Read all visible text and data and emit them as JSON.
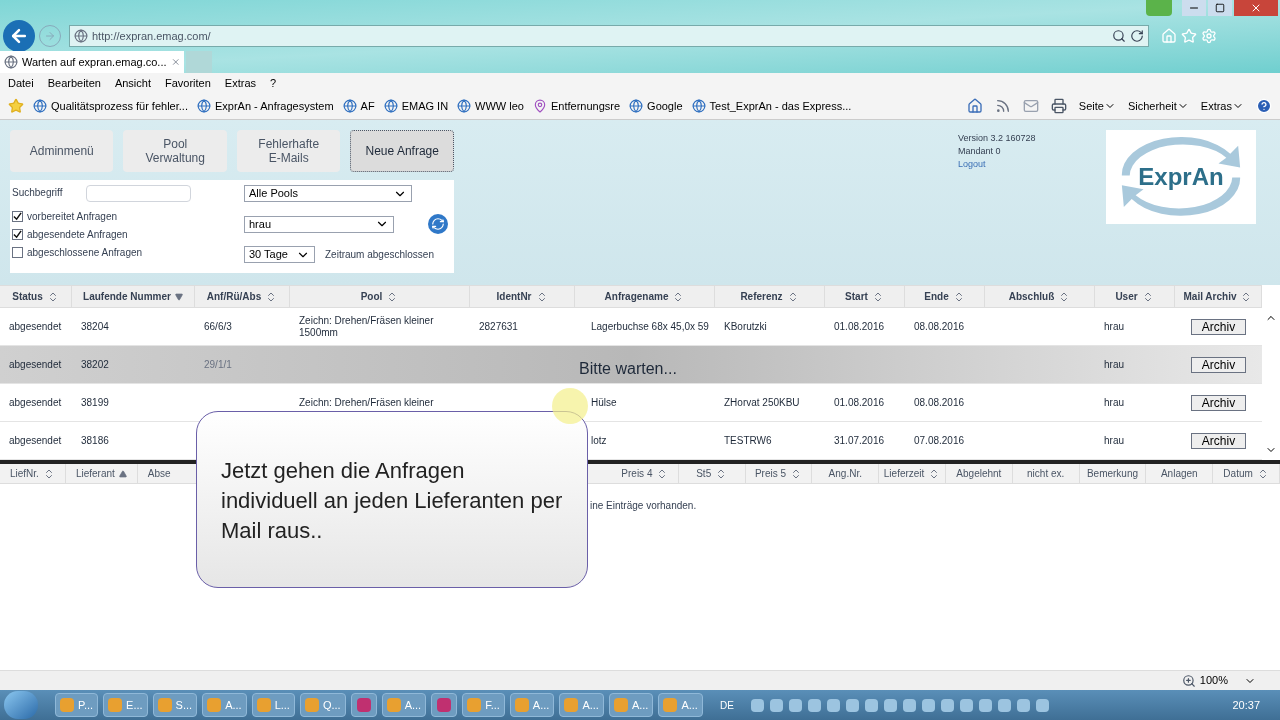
{
  "browser": {
    "url": "http://expran.emag.com/",
    "tab_title": "Warten auf expran.emag.co...",
    "menu": [
      "Datei",
      "Bearbeiten",
      "Ansicht",
      "Favoriten",
      "Extras",
      "?"
    ],
    "favorites": [
      "Qualitätsprozess für fehler...",
      "ExprAn - Anfragesystem",
      "AF",
      "EMAG IN",
      "WWW leo",
      "Entfernungsre",
      "Google",
      "Test_ExprAn - das Express..."
    ],
    "commands": [
      "Seite",
      "Sicherheit",
      "Extras"
    ]
  },
  "app": {
    "nav": [
      {
        "label": "Adminmenü",
        "selected": false
      },
      {
        "label": "Pool\nVerwaltung",
        "selected": false
      },
      {
        "label": "Fehlerhafte\nE-Mails",
        "selected": false
      },
      {
        "label": "Neue Anfrage",
        "selected": true
      }
    ],
    "search_label": "Suchbegriff",
    "checkboxes": [
      {
        "label": "vorbereitet Anfragen",
        "checked": true
      },
      {
        "label": "abgesendete Anfragen",
        "checked": true
      },
      {
        "label": "abgeschlossene Anfragen",
        "checked": false
      }
    ],
    "pool_select": "Alle Pools",
    "user_select": "hrau",
    "period_select": "30 Tage",
    "period_label": "Zeitraum abgeschlossen",
    "version": "Version 3.2 160728",
    "mandant": "Mandant 0",
    "logout": "Logout",
    "logo": "ExprAn"
  },
  "table": {
    "columns": [
      {
        "label": "Status",
        "kind": "sortable"
      },
      {
        "label": "Laufende Nummer",
        "kind": "descending"
      },
      {
        "label": "Anf/Rü/Abs",
        "kind": "sortable"
      },
      {
        "label": "Pool",
        "kind": "sortable"
      },
      {
        "label": "IdentNr",
        "kind": "sortable"
      },
      {
        "label": "Anfragename",
        "kind": "sortable"
      },
      {
        "label": "Referenz",
        "kind": "sortable"
      },
      {
        "label": "Start",
        "kind": "sortable"
      },
      {
        "label": "Ende",
        "kind": "sortable"
      },
      {
        "label": "Abschluß",
        "kind": "sortable"
      },
      {
        "label": "User",
        "kind": "sortable"
      },
      {
        "label": "Mail Archiv",
        "kind": "sortable"
      }
    ],
    "rows": [
      {
        "busy": false,
        "cells": [
          "abgesendet",
          "38204",
          "66/6/3",
          "Zeichn: Drehen/Fräsen kleiner 1500mm",
          "2827631",
          "Lagerbuchse 68x 45,0x 59",
          "KBorutzki",
          "01.08.2016",
          "08.08.2016",
          "",
          "hrau"
        ],
        "button": "Archiv"
      },
      {
        "busy": true,
        "cells": [
          "abgesendet",
          "38202",
          "29/1/1",
          "",
          "",
          "",
          "",
          "",
          "",
          "",
          "hrau"
        ],
        "button": "Archiv"
      },
      {
        "busy": false,
        "cells": [
          "abgesendet",
          "38199",
          "",
          "Zeichn: Drehen/Fräsen kleiner",
          "",
          "Hülse",
          "ZHorvat 250KBU",
          "01.08.2016",
          "08.08.2016",
          "",
          "hrau"
        ],
        "button": "Archiv"
      },
      {
        "busy": false,
        "cells": [
          "abgesendet",
          "38186",
          "",
          "",
          "",
          "lotz",
          "TESTRW6",
          "31.07.2016",
          "07.08.2016",
          "",
          "hrau"
        ],
        "button": "Archiv"
      }
    ],
    "loading_text": "Bitte warten..."
  },
  "details": {
    "columns_left": [
      {
        "label": "LiefNr.",
        "kind": "sortable"
      },
      {
        "label": "Lieferant",
        "kind": "ascending"
      },
      {
        "label": "Abse",
        "kind": "plain"
      }
    ],
    "columns_right": [
      {
        "label": "Preis 4",
        "kind": "sortable"
      },
      {
        "label": "St5",
        "kind": "sortable"
      },
      {
        "label": "Preis 5",
        "kind": "sortable"
      },
      {
        "label": "Ang.Nr.",
        "kind": "plain"
      },
      {
        "label": "Lieferzeit",
        "kind": "sortable"
      },
      {
        "label": "Abgelehnt",
        "kind": "plain"
      },
      {
        "label": "nicht ex.",
        "kind": "plain"
      },
      {
        "label": "Bemerkung",
        "kind": "plain"
      },
      {
        "label": "Anlagen",
        "kind": "plain"
      },
      {
        "label": "Datum",
        "kind": "sortable"
      }
    ],
    "empty_text": "ine Einträge vorhanden."
  },
  "callout": "Jetzt gehen die Anfragen individuell an jeden Lieferanten per Mail raus..",
  "status_bar": {
    "zoom": "100%"
  },
  "taskbar": {
    "items": [
      {
        "kind": "labeled",
        "label": "P..."
      },
      {
        "kind": "labeled",
        "label": "E..."
      },
      {
        "kind": "labeled",
        "label": "S..."
      },
      {
        "kind": "labeled",
        "label": "A..."
      },
      {
        "kind": "labeled",
        "label": "L..."
      },
      {
        "kind": "labeled",
        "label": "Q..."
      },
      {
        "kind": "icon"
      },
      {
        "kind": "labeled",
        "label": "A..."
      },
      {
        "kind": "icon"
      },
      {
        "kind": "labeled",
        "label": "F..."
      },
      {
        "kind": "labeled",
        "label": "A..."
      },
      {
        "kind": "labeled",
        "label": "A..."
      },
      {
        "kind": "labeled",
        "label": "A..."
      },
      {
        "kind": "labeled",
        "label": "A..."
      }
    ],
    "language": "DE",
    "clock": "20:37"
  }
}
